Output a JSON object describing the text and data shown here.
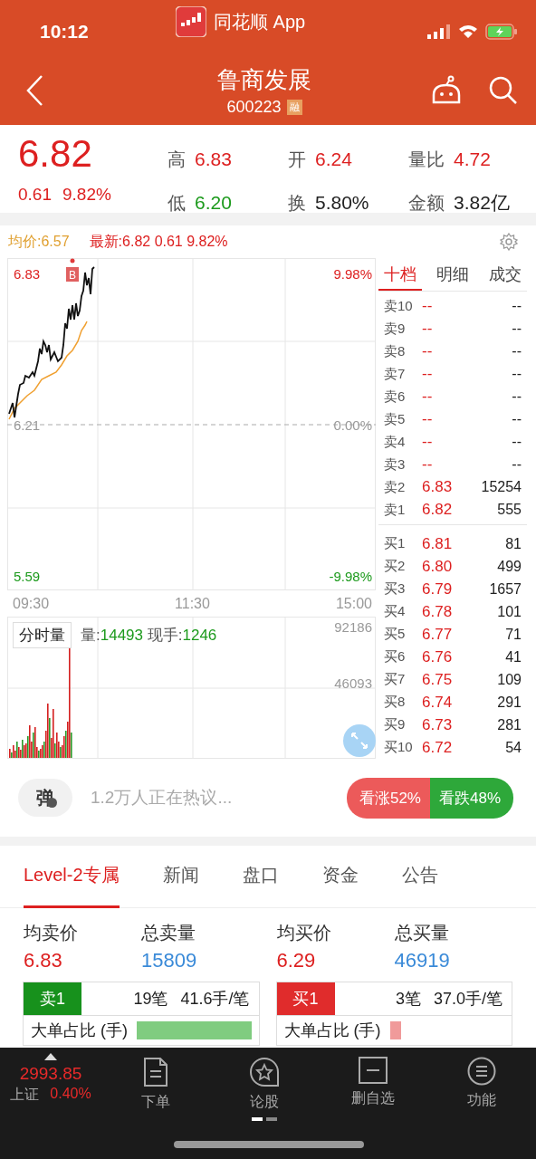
{
  "status_bar": {
    "time": "10:12",
    "app": "同花顺 App"
  },
  "header": {
    "title": "鲁商发展",
    "code": "600223",
    "badge": "融"
  },
  "quote": {
    "price": "6.82",
    "change": "0.61",
    "change_pct": "9.82%",
    "stats": [
      {
        "label": "高",
        "value": "6.83",
        "kind": "up"
      },
      {
        "label": "开",
        "value": "6.24",
        "kind": "up"
      },
      {
        "label": "量比",
        "value": "4.72",
        "kind": "up"
      },
      {
        "label": "低",
        "value": "6.20",
        "kind": "down"
      },
      {
        "label": "换",
        "value": "5.80%",
        "kind": "flat"
      },
      {
        "label": "金额",
        "value": "3.82亿",
        "kind": "flat"
      }
    ]
  },
  "chart": {
    "avg_label": "均价:6.57",
    "latest": "最新:6.82 0.61 9.82%",
    "price_high": "6.83",
    "price_base": "6.21",
    "price_low": "5.59",
    "pct_high": "9.98%",
    "pct_base": "0.00%",
    "pct_low": "-9.98%",
    "times": [
      "09:30",
      "11:30",
      "15:00"
    ],
    "b_marker": "B",
    "volume_tab": "分时量",
    "volume_label": "量:",
    "volume": "14493",
    "current_label": "现手:",
    "current": "1246",
    "vol_ticks": [
      "92186",
      "46093"
    ]
  },
  "order_book": {
    "tabs": [
      {
        "label": "十档",
        "selected": true
      },
      {
        "label": "明细",
        "selected": false
      },
      {
        "label": "成交",
        "selected": false
      }
    ],
    "asks": [
      {
        "label": "卖10",
        "price": "--",
        "volume": "--"
      },
      {
        "label": "卖9",
        "price": "--",
        "volume": "--"
      },
      {
        "label": "卖8",
        "price": "--",
        "volume": "--"
      },
      {
        "label": "卖7",
        "price": "--",
        "volume": "--"
      },
      {
        "label": "卖6",
        "price": "--",
        "volume": "--"
      },
      {
        "label": "卖5",
        "price": "--",
        "volume": "--"
      },
      {
        "label": "卖4",
        "price": "--",
        "volume": "--"
      },
      {
        "label": "卖3",
        "price": "--",
        "volume": "--"
      },
      {
        "label": "卖2",
        "price": "6.83",
        "volume": "15254"
      },
      {
        "label": "卖1",
        "price": "6.82",
        "volume": "555"
      }
    ],
    "bids": [
      {
        "label": "买1",
        "price": "6.81",
        "volume": "81"
      },
      {
        "label": "买2",
        "price": "6.80",
        "volume": "499"
      },
      {
        "label": "买3",
        "price": "6.79",
        "volume": "1657"
      },
      {
        "label": "买4",
        "price": "6.78",
        "volume": "101"
      },
      {
        "label": "买5",
        "price": "6.77",
        "volume": "71"
      },
      {
        "label": "买6",
        "price": "6.76",
        "volume": "41"
      },
      {
        "label": "买7",
        "price": "6.75",
        "volume": "109"
      },
      {
        "label": "买8",
        "price": "6.74",
        "volume": "291"
      },
      {
        "label": "买9",
        "price": "6.73",
        "volume": "281"
      },
      {
        "label": "买10",
        "price": "6.72",
        "volume": "54"
      }
    ]
  },
  "comments": {
    "button": "弹",
    "text": "1.2万人正在热议...",
    "bull": "看涨52%",
    "bear": "看跌48%"
  },
  "tabs": [
    {
      "label": "Level-2专属",
      "selected": true
    },
    {
      "label": "新闻",
      "selected": false
    },
    {
      "label": "盘口",
      "selected": false
    },
    {
      "label": "资金",
      "selected": false
    },
    {
      "label": "公告",
      "selected": false
    }
  ],
  "level2": [
    {
      "kind": "sell",
      "avg_label": "均卖价",
      "avg": "6.83",
      "total_label": "总卖量",
      "total": "15809",
      "tag": "卖1",
      "orders": "19笔",
      "per": "41.6手/笔",
      "ratio_label": "大单占比 (手)"
    },
    {
      "kind": "buy",
      "avg_label": "均买价",
      "avg": "6.29",
      "total_label": "总买量",
      "total": "46919",
      "tag": "买1",
      "orders": "3笔",
      "per": "37.0手/笔",
      "ratio_label": "大单占比 (手)"
    }
  ],
  "bottom_nav": {
    "index_value": "2993.85",
    "index_name": "上证",
    "index_pct": "0.40%",
    "items": [
      {
        "label": "下单"
      },
      {
        "label": "论股"
      },
      {
        "label": "删自选"
      },
      {
        "label": "功能"
      }
    ]
  }
}
